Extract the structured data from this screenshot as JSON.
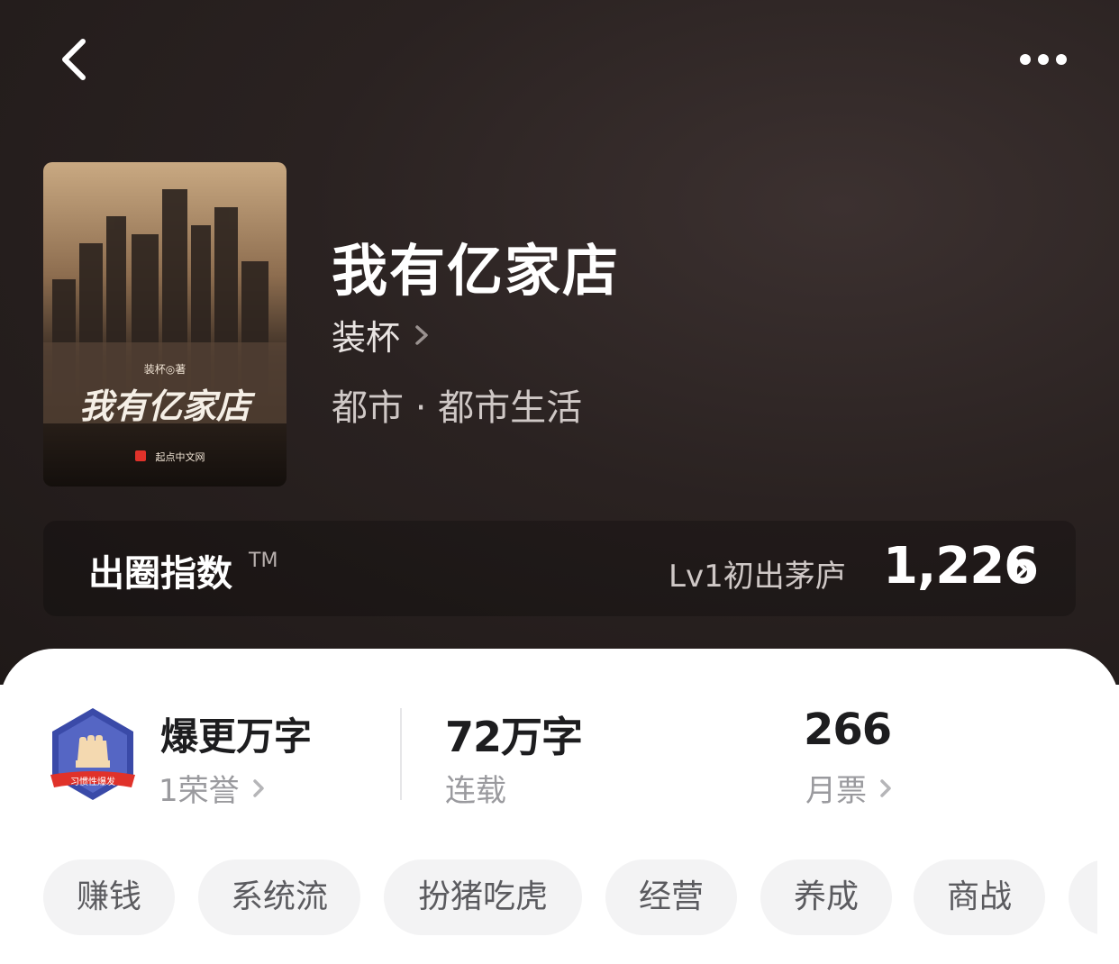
{
  "nav": {
    "back_icon": "chevron-left-icon",
    "more_icon": "more-dots-icon"
  },
  "book": {
    "title": "我有亿家店",
    "author": "装杯",
    "genre": "都市 · 都市生活",
    "cover": {
      "author_credit": "装杯◎著",
      "title_calligraphy": "我有亿家店",
      "publisher": "起点中文网"
    }
  },
  "index": {
    "label": "出圈指数",
    "tm": "TM",
    "level": "Lv1初出茅庐",
    "value": "1,226"
  },
  "stats": {
    "badge_text": "习惯性爆发",
    "honor_title": "爆更万字",
    "honor_sub": "1荣誉",
    "words_value": "72万字",
    "words_sub": "连载",
    "tickets_value": "266",
    "tickets_sub": "月票"
  },
  "tags": [
    "赚钱",
    "系统流",
    "扮猪吃虎",
    "经营",
    "养成",
    "商战"
  ],
  "colors": {
    "hero_bg": "#2a2221",
    "accent_red": "#e0322a",
    "badge_blue": "#3a4aa8"
  }
}
